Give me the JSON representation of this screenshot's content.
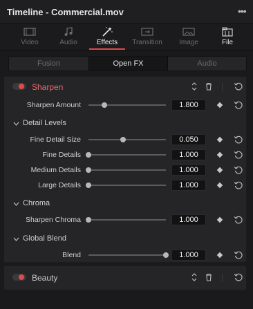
{
  "window": {
    "title": "Timeline - Commercial.mov"
  },
  "inspector_tabs": [
    {
      "label": "Video",
      "icon": "video-icon"
    },
    {
      "label": "Audio",
      "icon": "audio-icon"
    },
    {
      "label": "Effects",
      "icon": "effects-wand-icon"
    },
    {
      "label": "Transition",
      "icon": "transition-icon"
    },
    {
      "label": "Image",
      "icon": "image-icon"
    },
    {
      "label": "File",
      "icon": "file-icon"
    }
  ],
  "active_tab": "Effects",
  "accent_color": "#e04a4a",
  "segments": [
    {
      "label": "Fusion"
    },
    {
      "label": "Open FX"
    },
    {
      "label": "Audio"
    }
  ],
  "active_segment": "Open FX",
  "effects": {
    "sharpen": {
      "name": "Sharpen",
      "enabled": true,
      "params": {
        "sharpen_amount": {
          "label": "Sharpen Amount",
          "value": "1.800",
          "slider": 0.15
        }
      },
      "sections": {
        "detail_levels": {
          "title": "Detail Levels",
          "params": [
            {
              "label": "Fine Detail Size",
              "value": "0.050",
              "slider": 0.42
            },
            {
              "label": "Fine Details",
              "value": "1.000",
              "slider": 0.0
            },
            {
              "label": "Medium Details",
              "value": "1.000",
              "slider": 0.0
            },
            {
              "label": "Large Details",
              "value": "1.000",
              "slider": 0.0
            }
          ]
        },
        "chroma": {
          "title": "Chroma",
          "params": [
            {
              "label": "Sharpen Chroma",
              "value": "1.000",
              "slider": 0.0
            }
          ]
        },
        "global_blend": {
          "title": "Global Blend",
          "params": [
            {
              "label": "Blend",
              "value": "1.000",
              "slider": 1.0
            }
          ]
        }
      }
    },
    "beauty": {
      "name": "Beauty",
      "enabled": true
    }
  }
}
